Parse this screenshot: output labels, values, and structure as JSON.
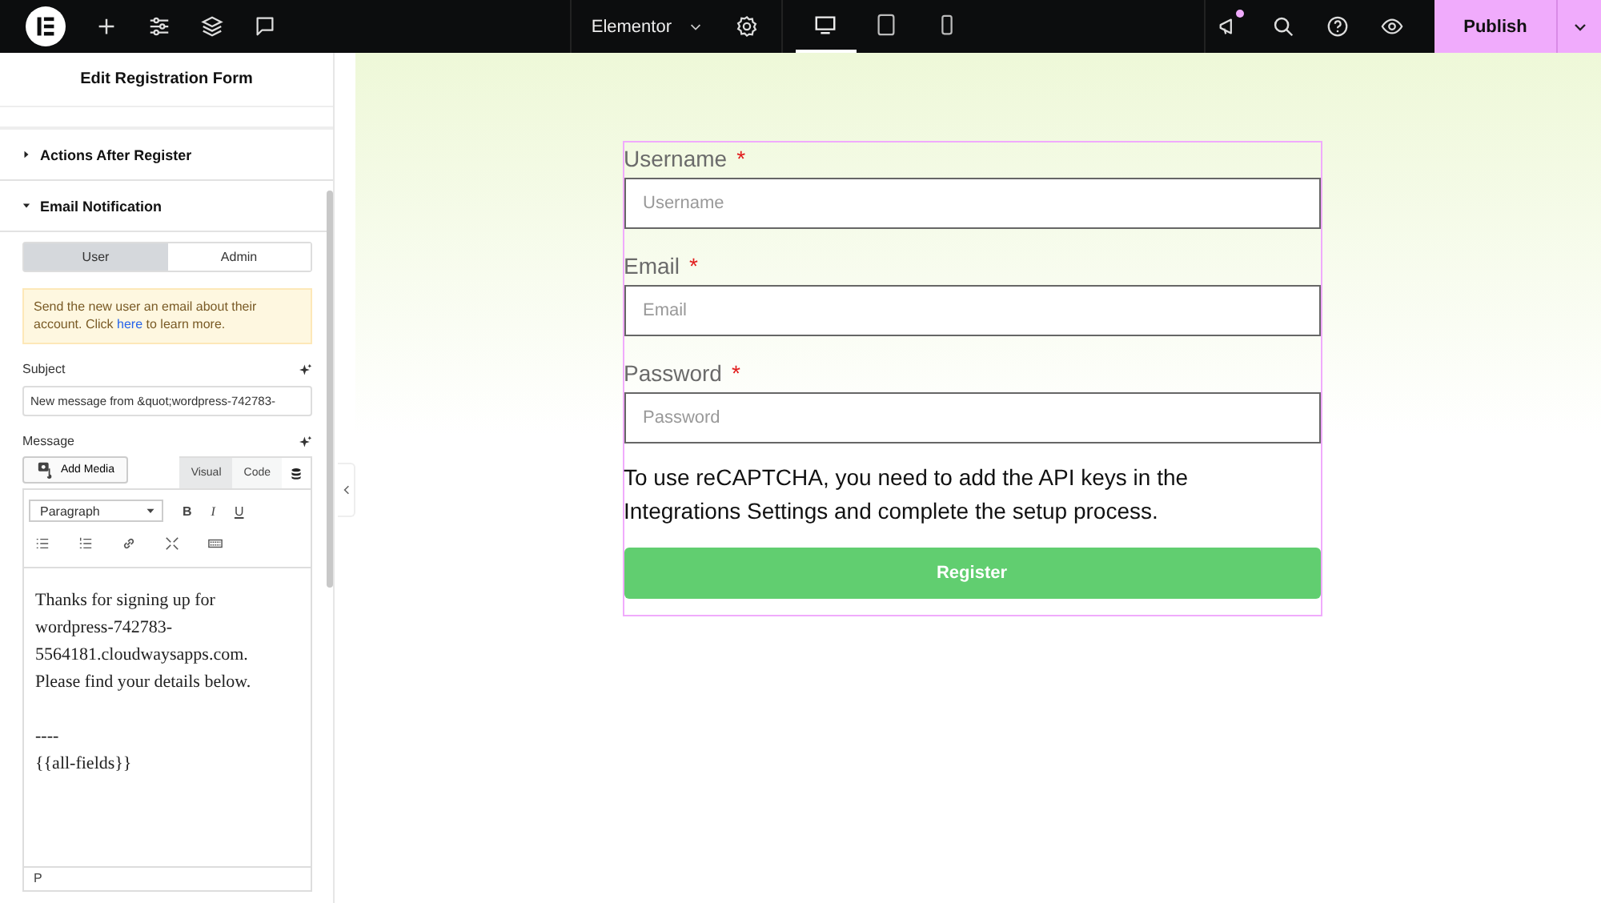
{
  "topbar": {
    "site_name": "Elementor",
    "devices": [
      {
        "kind": "desktop",
        "selected": true
      },
      {
        "kind": "tablet",
        "selected": false
      },
      {
        "kind": "mobile",
        "selected": false
      }
    ],
    "has_notification": true,
    "publish": "Publish"
  },
  "sidebar": {
    "title": "Edit Registration Form",
    "sections": [
      {
        "title": "Actions After Register",
        "expanded": false
      },
      {
        "title": "Email Notification",
        "expanded": true
      }
    ],
    "recipient_tabs": [
      {
        "label": "User",
        "selected": true
      },
      {
        "label": "Admin",
        "selected": false
      }
    ],
    "notice": {
      "before": "Send the new user an email about their account. Click",
      "link": "here",
      "after": "to learn more."
    },
    "subject": {
      "label": "Subject",
      "value": "New message from &quot;wordpress-742783-"
    },
    "message": {
      "label": "Message",
      "add_media": "Add Media",
      "editor_tabs": [
        {
          "label": "Visual",
          "selected": true
        },
        {
          "label": "Code",
          "selected": false
        }
      ],
      "format": "Paragraph",
      "format_buttons": [
        {
          "kind": "bold",
          "label": "B"
        },
        {
          "kind": "italic",
          "label": "I"
        },
        {
          "kind": "underline",
          "label": "U"
        }
      ],
      "paragraphs": [
        [
          "Thanks for signing up for",
          "wordpress-742783-",
          "5564181.cloudwaysapps.com.",
          "Please find your details below."
        ],
        [
          "----",
          "{{all-fields}}"
        ]
      ],
      "path": "P"
    }
  },
  "form": {
    "fields": [
      {
        "label": "Username",
        "placeholder": "Username",
        "required": true
      },
      {
        "label": "Email",
        "placeholder": "Email",
        "required": true
      },
      {
        "label": "Password",
        "placeholder": "Password",
        "required": true
      }
    ],
    "required_mark": "*",
    "recaptcha_note": "To use reCAPTCHA, you need to add the API keys in the Integrations Settings and complete the setup process.",
    "submit": "Register"
  }
}
